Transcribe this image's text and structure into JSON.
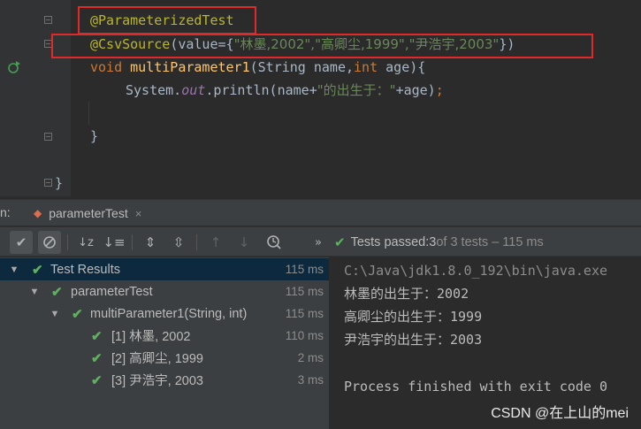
{
  "editor": {
    "lines": {
      "annotation1": "@ParameterizedTest",
      "annotation2_prefix": "@CsvSource",
      "annotation2_mid": "(value={",
      "annotation2_values": "\"林墨,2002\",\"高卿尘,1999\",\"尹浩宇,2003\"",
      "annotation2_suffix": "})",
      "method_kw": "void ",
      "method_name": "multiParameter1",
      "method_params_a": "(String name,",
      "method_params_int": "int",
      "method_params_b": " age){",
      "body_a": "System.",
      "body_out": "out",
      "body_b": ".println(name+",
      "body_str": "\"的出生于：\"",
      "body_c": "+age)",
      "body_semi": ";",
      "close_inner": "}",
      "close_outer": "}"
    }
  },
  "run_panel": {
    "label": "n:",
    "tab_label": "parameterTest",
    "close_glyph": "×",
    "status_passed": "Tests passed: ",
    "status_count": "3",
    "status_rest": " of 3 tests – 115 ms"
  },
  "toolbar": {
    "icons": [
      "check-icon",
      "stop-icon",
      "sort-alpha-icon",
      "sort-duration-icon",
      "expand-all-icon",
      "collapse-all-icon",
      "up-arrow-icon",
      "down-arrow-icon",
      "history-icon",
      "more-icon"
    ]
  },
  "tree": {
    "rows": [
      {
        "name": "Test Results",
        "time": "115 ms"
      },
      {
        "name": "parameterTest",
        "time": "115 ms"
      },
      {
        "name": "multiParameter1(String, int)",
        "time": "115 ms"
      },
      {
        "name": "[1] 林墨, 2002",
        "time": "110 ms"
      },
      {
        "name": "[2] 高卿尘, 1999",
        "time": "2 ms"
      },
      {
        "name": "[3] 尹浩宇, 2003",
        "time": "3 ms"
      }
    ]
  },
  "console": {
    "cmd": "C:\\Java\\jdk1.8.0_192\\bin\\java.exe",
    "out1": "林墨的出生于：2002",
    "out2": "高卿尘的出生于：1999",
    "out3": "尹浩宇的出生于：2003",
    "exit": "Process finished with exit code 0"
  },
  "watermark": "CSDN @在上山的mei",
  "colors": {
    "annotation": "#bbb529",
    "keyword": "#cc7832",
    "string": "#6a8759",
    "method": "#ffc66d",
    "pass": "#5fb05f",
    "highlight_box": "#e02a2a"
  }
}
